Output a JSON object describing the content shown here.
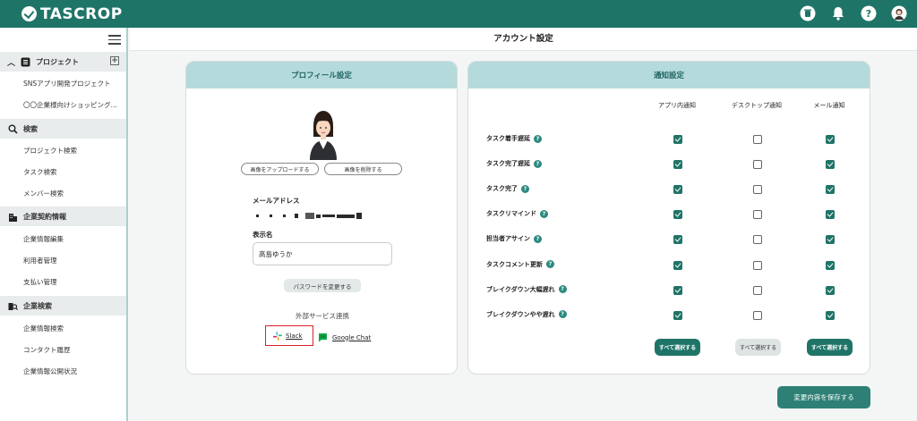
{
  "app": {
    "brand": "TASCROP",
    "accent": "#1f7468"
  },
  "header": {
    "icons": [
      "trash-icon",
      "bell-icon",
      "help-icon",
      "user-avatar-icon"
    ]
  },
  "sidebar": {
    "sections": [
      {
        "title": "プロジェクト",
        "icon": "project-icon",
        "items": [
          "SNSアプリ開発プロジェクト",
          "〇〇企業様向けショッピング…"
        ]
      },
      {
        "title": "検索",
        "icon": "search-icon",
        "items": [
          "プロジェクト検索",
          "タスク検索",
          "メンバー検索"
        ]
      },
      {
        "title": "企業契約情報",
        "icon": "building-icon",
        "items": [
          "企業情報編集",
          "利用者管理",
          "支払い管理"
        ]
      },
      {
        "title": "企業検索",
        "icon": "company-search-icon",
        "items": [
          "企業情報検索",
          "コンタクト履歴",
          "企業情報公開状況"
        ]
      }
    ]
  },
  "page": {
    "title": "アカウント設定",
    "save_label": "変更内容を保存する"
  },
  "profile": {
    "heading": "プロフィール設定",
    "upload_label": "画像をアップロードする",
    "delete_label": "画像を削除する",
    "email_label": "メールアドレス",
    "display_name_label": "表示名",
    "display_name_value": "高島ゆうか",
    "password_label": "パスワードを変更する",
    "external_label": "外部サービス連携",
    "slack_label": "Slack",
    "gchat_label": "Google Chat"
  },
  "notifications": {
    "heading": "通知設定",
    "columns": [
      "アプリ内通知",
      "デスクトップ通知",
      "メール通知"
    ],
    "rows": [
      {
        "label": "タスク着手遅延",
        "values": [
          true,
          false,
          true
        ]
      },
      {
        "label": "タスク完了遅延",
        "values": [
          true,
          false,
          true
        ]
      },
      {
        "label": "タスク完了",
        "values": [
          true,
          false,
          true
        ]
      },
      {
        "label": "タスクリマインド",
        "values": [
          true,
          false,
          true
        ]
      },
      {
        "label": "担当者アサイン",
        "values": [
          true,
          false,
          true
        ]
      },
      {
        "label": "タスクコメント更新",
        "values": [
          true,
          false,
          true
        ]
      },
      {
        "label": "ブレイクダウン大幅遅れ",
        "values": [
          true,
          false,
          true
        ]
      },
      {
        "label": "ブレイクダウンやや遅れ",
        "values": [
          true,
          false,
          true
        ]
      }
    ],
    "select_all_label": "すべて選択する"
  }
}
